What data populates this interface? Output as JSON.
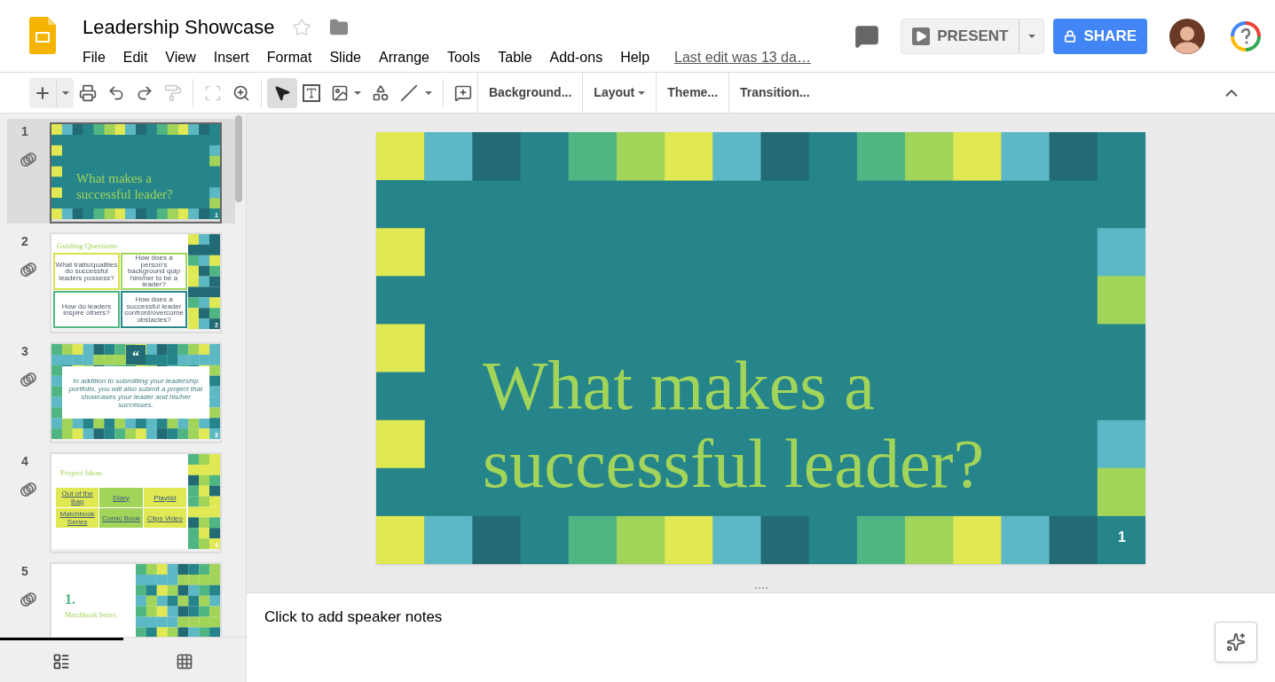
{
  "document": {
    "title": "Leadership Showcase",
    "starred": false
  },
  "menu": [
    "File",
    "Edit",
    "View",
    "Insert",
    "Format",
    "Slide",
    "Arrange",
    "Tools",
    "Table",
    "Add-ons",
    "Help"
  ],
  "last_edit": "Last edit was 13 da…",
  "present": "PRESENT",
  "share": "SHARE",
  "toolbar": {
    "paint_format": {
      "disabled": true
    },
    "fit": {
      "disabled": true
    },
    "select_tool": {
      "selected": true
    },
    "buttons": [
      {
        "label": "Background...",
        "dropdown": false
      },
      {
        "label": "Layout",
        "dropdown": true
      },
      {
        "label": "Theme...",
        "dropdown": false
      },
      {
        "label": "Transition...",
        "dropdown": false
      }
    ]
  },
  "slides": [
    {
      "kind": "title",
      "number": "1",
      "selected": true,
      "page_number": "1",
      "title": "What makes a successful leader?"
    },
    {
      "kind": "questions",
      "number": "2",
      "selected": false,
      "page_number": "2",
      "heading": "Guiding Questions",
      "questions": [
        {
          "text": "What traits/qualities do successful leaders possess?",
          "color": "#d8e24c"
        },
        {
          "text": "How does a person's background quip him/her to be a leader?",
          "color": "#a3d45a"
        },
        {
          "text": "How do leaders inspire others?",
          "color": "#4fb683"
        },
        {
          "text": "How does a successful leader confront/overcome obstacles?",
          "color": "#25858a"
        }
      ]
    },
    {
      "kind": "quote",
      "number": "3",
      "selected": false,
      "page_number": "3",
      "mark": "“",
      "text": "In addition to submitting your leadership portfolio, you will also submit a project that showcases your leader and his/her successes."
    },
    {
      "kind": "table",
      "number": "4",
      "selected": false,
      "page_number": "4",
      "heading": "Project Ideas",
      "cells": [
        {
          "text": "Out of the Bag",
          "color": "#e0e853"
        },
        {
          "text": "Diary",
          "color": "#a3d45a"
        },
        {
          "text": "Playlist",
          "color": "#e0e853"
        },
        {
          "text": "Matchbook Series",
          "color": "#e0e853"
        },
        {
          "text": "Comic Book",
          "color": "#a3d45a"
        },
        {
          "text": "Clips Video",
          "color": "#e0e853"
        }
      ]
    },
    {
      "kind": "section",
      "number": "5",
      "selected": false,
      "numeral": "1.",
      "heading": "Matchbook Series"
    }
  ],
  "main_slide": {
    "title": "What makes a successful leader?",
    "page_number": "1"
  },
  "notes": {
    "placeholder": "Click to add speaker notes"
  },
  "view_modes": [
    {
      "kind": "filmstrip",
      "selected": true
    },
    {
      "kind": "grid",
      "selected": false
    }
  ]
}
